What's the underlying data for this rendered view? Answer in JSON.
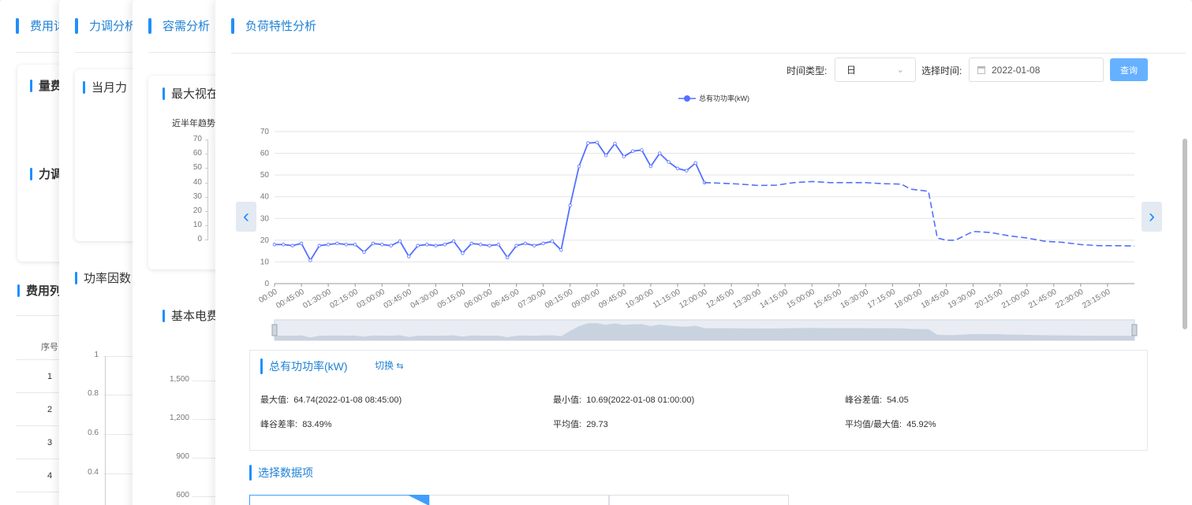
{
  "tabs": [
    {
      "title": "费用详情"
    },
    {
      "title": "力调分析"
    },
    {
      "title": "容需分析"
    },
    {
      "title": "负荷特性分析"
    }
  ],
  "card1": {
    "panel_title_1": "量费",
    "panel_title_2": "力调",
    "list_title": "费用列",
    "col_index": "序号",
    "rows": [
      "1",
      "2",
      "3",
      "4"
    ]
  },
  "card2": {
    "panel_title": "当月力",
    "pf_title": "功率因数",
    "y_ticks": [
      "1",
      "0.8",
      "0.6",
      "0.4"
    ]
  },
  "card3": {
    "panel_title": "最大视在",
    "trend_label": "近半年趋势",
    "y_ticks": [
      "70",
      "60",
      "50",
      "40",
      "30",
      "20",
      "10",
      "0"
    ],
    "basic_title": "基本电费",
    "y_ticks_2": [
      "1,500",
      "1,200",
      "900",
      "600"
    ]
  },
  "main": {
    "time_type_label": "时间类型:",
    "time_type_value": "日",
    "select_time_label": "选择时间:",
    "date_value": "2022-01-08",
    "query_button": "查询",
    "stats_title": "总有功功率(kW)",
    "switch_label": "切换",
    "stats": {
      "max_label": "最大值:",
      "max_value": "64.74(2022-01-08 08:45:00)",
      "min_label": "最小值:",
      "min_value": "10.69(2022-01-08 01:00:00)",
      "peak_valley_diff_label": "峰谷差值:",
      "peak_valley_diff_value": "54.05",
      "peak_valley_rate_label": "峰谷差率:",
      "peak_valley_rate_value": "83.49%",
      "avg_label": "平均值:",
      "avg_value": "29.73",
      "avg_max_label": "平均值/最大值:",
      "avg_max_value": "45.92%"
    },
    "data_items_title": "选择数据项"
  },
  "chart_data": {
    "type": "line",
    "series": [
      {
        "name": "总有功功率(kW)",
        "color": "#5470ff"
      }
    ],
    "ylim": [
      0,
      70
    ],
    "y_ticks": [
      0,
      10,
      20,
      30,
      40,
      50,
      60,
      70
    ],
    "x_ticks": [
      "00:00",
      "00:45:00",
      "01:30:00",
      "02:15:00",
      "03:00:00",
      "03:45:00",
      "04:30:00",
      "05:15:00",
      "06:00:00",
      "06:45:00",
      "07:30:00",
      "08:15:00",
      "09:00:00",
      "09:45:00",
      "10:30:00",
      "11:15:00",
      "12:00:00",
      "12:45:00",
      "13:30:00",
      "14:15:00",
      "15:00:00",
      "15:45:00",
      "16:30:00",
      "17:15:00",
      "18:00:00",
      "18:45:00",
      "19:30:00",
      "20:15:00",
      "21:00:00",
      "21:45:00",
      "22:30:00",
      "23:15:00"
    ],
    "x_hours_range": [
      0,
      24
    ],
    "solid": {
      "x": [
        0,
        0.25,
        0.5,
        0.75,
        1.0,
        1.25,
        1.5,
        1.75,
        2.0,
        2.25,
        2.5,
        2.75,
        3.0,
        3.25,
        3.5,
        3.75,
        4.0,
        4.25,
        4.5,
        4.75,
        5.0,
        5.25,
        5.5,
        5.75,
        6.0,
        6.25,
        6.5,
        6.75,
        7.0,
        7.25,
        7.5,
        7.75,
        8.0,
        8.25,
        8.5,
        8.75,
        9.0,
        9.25,
        9.5,
        9.75,
        10.0,
        10.25,
        10.5,
        10.75,
        11.0,
        11.25,
        11.5,
        11.75,
        12.0
      ],
      "y": [
        18,
        18,
        17.5,
        18.5,
        10.7,
        17.5,
        18,
        18.5,
        18,
        18,
        14.5,
        18.5,
        18,
        17.5,
        19.5,
        12.5,
        17.5,
        18,
        17.5,
        18,
        19.5,
        14,
        18.5,
        18,
        17.5,
        18,
        12,
        17.5,
        18.5,
        17.5,
        18.5,
        19.5,
        15.5,
        36,
        54,
        64.7,
        65,
        59,
        64.5,
        58.5,
        61,
        61.5,
        54,
        60,
        56,
        53,
        52,
        55.5,
        46.5
      ]
    },
    "dashed": {
      "x": [
        12.0,
        12.5,
        13.0,
        13.5,
        14.0,
        14.5,
        15.0,
        15.5,
        16.0,
        16.5,
        17.0,
        17.5,
        17.75,
        18.0,
        18.25,
        18.5,
        18.75,
        19.0,
        19.5,
        20.0,
        20.5,
        21.0,
        21.5,
        22.0,
        22.5,
        23.0,
        23.5,
        24.0
      ],
      "y": [
        46.5,
        46.2,
        45.8,
        45.2,
        45.3,
        46.5,
        47,
        46.5,
        46.5,
        46.5,
        46,
        45.8,
        43.5,
        43,
        42.5,
        21,
        20,
        20,
        24,
        23.5,
        22,
        21,
        19.5,
        19,
        18,
        17.5,
        17.5,
        17.3
      ]
    },
    "legend_position": "top-center",
    "grid": true
  }
}
